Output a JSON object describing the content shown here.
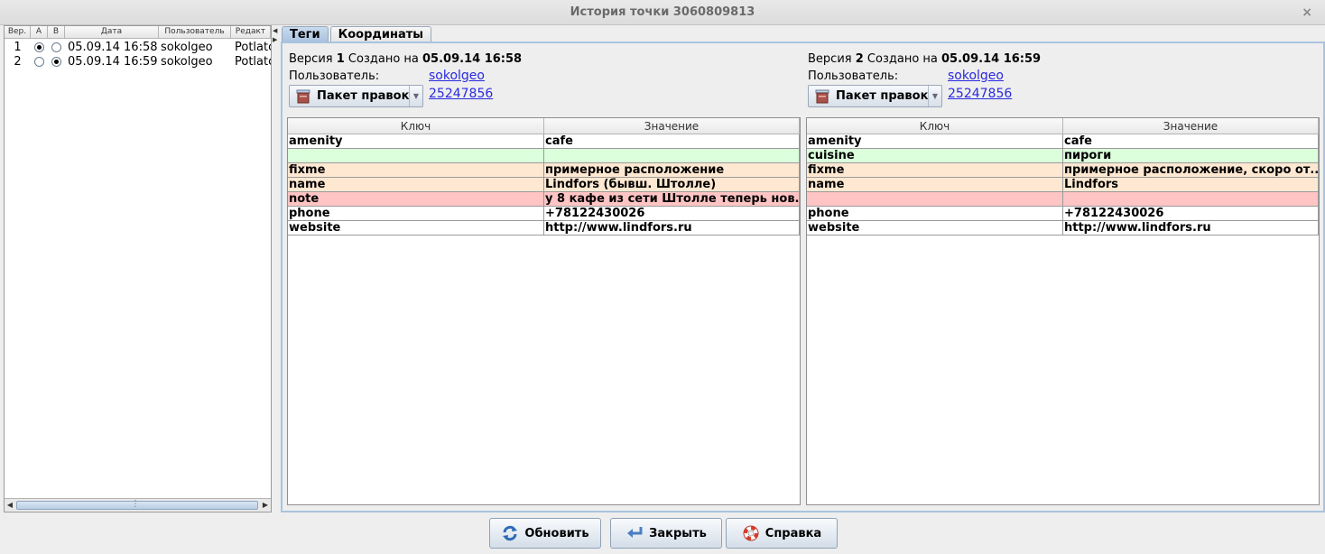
{
  "window": {
    "title": "История точки 3060809813",
    "close_glyph": "×"
  },
  "history_table": {
    "headers": [
      "Вер.",
      "A",
      "B",
      "Дата",
      "Пользователь",
      "Редакт"
    ],
    "rows": [
      {
        "ver": "1",
        "a_selected": true,
        "b_selected": false,
        "date": "05.09.14 16:58",
        "user": "sokolgeo",
        "editor": "Potlatch"
      },
      {
        "ver": "2",
        "a_selected": false,
        "b_selected": true,
        "date": "05.09.14 16:59",
        "user": "sokolgeo",
        "editor": "Potlatch"
      }
    ]
  },
  "tabs": [
    {
      "label": "Теги",
      "active": true
    },
    {
      "label": "Координаты",
      "active": false
    }
  ],
  "versions": [
    {
      "prefix": "Версия",
      "number": "1",
      "created_label": "Создано на",
      "date": "05.09.14 16:58",
      "user_label": "Пользователь:",
      "user": "sokolgeo",
      "changeset_button": "Пакет правок",
      "changeset_id": "25247856",
      "headers": [
        "Ключ",
        "Значение"
      ],
      "rows": [
        {
          "key": "amenity",
          "value": "cafe",
          "status": "same"
        },
        {
          "key": "",
          "value": "",
          "status": "added"
        },
        {
          "key": "fixme",
          "value": "примерное расположение",
          "status": "changed"
        },
        {
          "key": "name",
          "value": "Lindfors (бывш. Штолле)",
          "status": "changed"
        },
        {
          "key": "note",
          "value": "у 8 кафе из сети Штолле теперь нов...",
          "status": "removed"
        },
        {
          "key": "phone",
          "value": "+78122430026",
          "status": "same"
        },
        {
          "key": "website",
          "value": "http://www.lindfors.ru",
          "status": "same"
        }
      ]
    },
    {
      "prefix": "Версия",
      "number": "2",
      "created_label": "Создано на",
      "date": "05.09.14 16:59",
      "user_label": "Пользователь:",
      "user": "sokolgeo",
      "changeset_button": "Пакет правок",
      "changeset_id": "25247856",
      "headers": [
        "Ключ",
        "Значение"
      ],
      "rows": [
        {
          "key": "amenity",
          "value": "cafe",
          "status": "same"
        },
        {
          "key": "cuisine",
          "value": "пироги",
          "status": "added"
        },
        {
          "key": "fixme",
          "value": "примерное расположение, скоро от...",
          "status": "changed"
        },
        {
          "key": "name",
          "value": "Lindfors",
          "status": "changed"
        },
        {
          "key": "",
          "value": "",
          "status": "removed"
        },
        {
          "key": "phone",
          "value": "+78122430026",
          "status": "same"
        },
        {
          "key": "website",
          "value": "http://www.lindfors.ru",
          "status": "same"
        }
      ]
    }
  ],
  "buttons": {
    "refresh": "Обновить",
    "close": "Закрыть",
    "help": "Справка"
  },
  "colors": {
    "same": "#ffffff",
    "added": "#dcffdc",
    "changed": "#ffe8d2",
    "removed": "#ffc4c4",
    "link": "#2a2ae0"
  }
}
